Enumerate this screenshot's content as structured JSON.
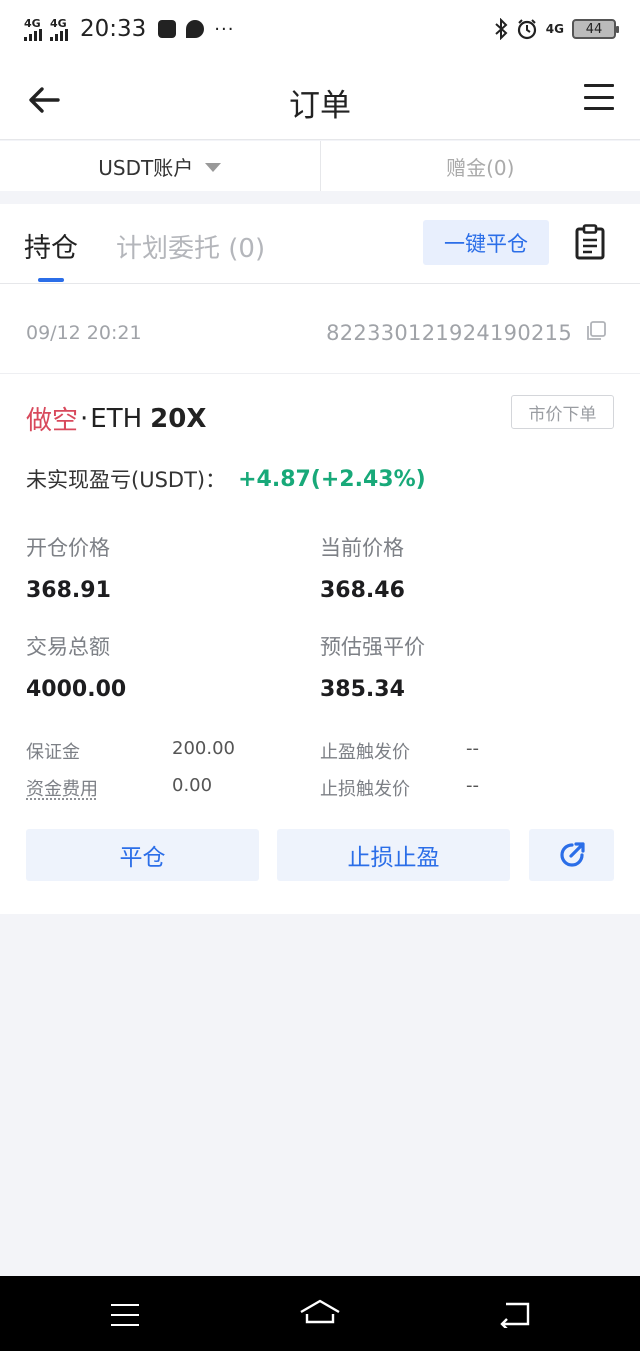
{
  "status_bar": {
    "net1": "4G",
    "net2": "4G",
    "time": "20:33",
    "dots": "···",
    "net3": "4G",
    "battery": "44"
  },
  "nav": {
    "title": "订单"
  },
  "accounts": {
    "active": "USDT账户",
    "bonus": "赠金(0)"
  },
  "tabs": {
    "positions": "持仓",
    "plan": "计划委托 (0)",
    "close_all": "一键平仓"
  },
  "position": {
    "time": "09/12 20:21",
    "order_id": "822330121924190215",
    "side": "做空",
    "dot": "·",
    "pair": "ETH",
    "leverage": "20X",
    "order_type": "市价下单",
    "pnl_label": "未实现盈亏(USDT)：",
    "pnl_value": "+4.87(+2.43%)",
    "open_price_label": "开仓价格",
    "open_price": "368.91",
    "current_price_label": "当前价格",
    "current_price": "368.46",
    "total_label": "交易总额",
    "total": "4000.00",
    "liq_label": "预估强平价",
    "liq_price": "385.34",
    "margin_label": "保证金",
    "margin": "200.00",
    "funding_label": "资金费用",
    "funding": "0.00",
    "tp_label": "止盈触发价",
    "tp": "--",
    "sl_label": "止损触发价",
    "sl": "--"
  },
  "actions": {
    "close": "平仓",
    "tpsl": "止损止盈"
  },
  "colors": {
    "accent": "#2b6ee8",
    "short": "#d8495c",
    "profit": "#18a979"
  }
}
